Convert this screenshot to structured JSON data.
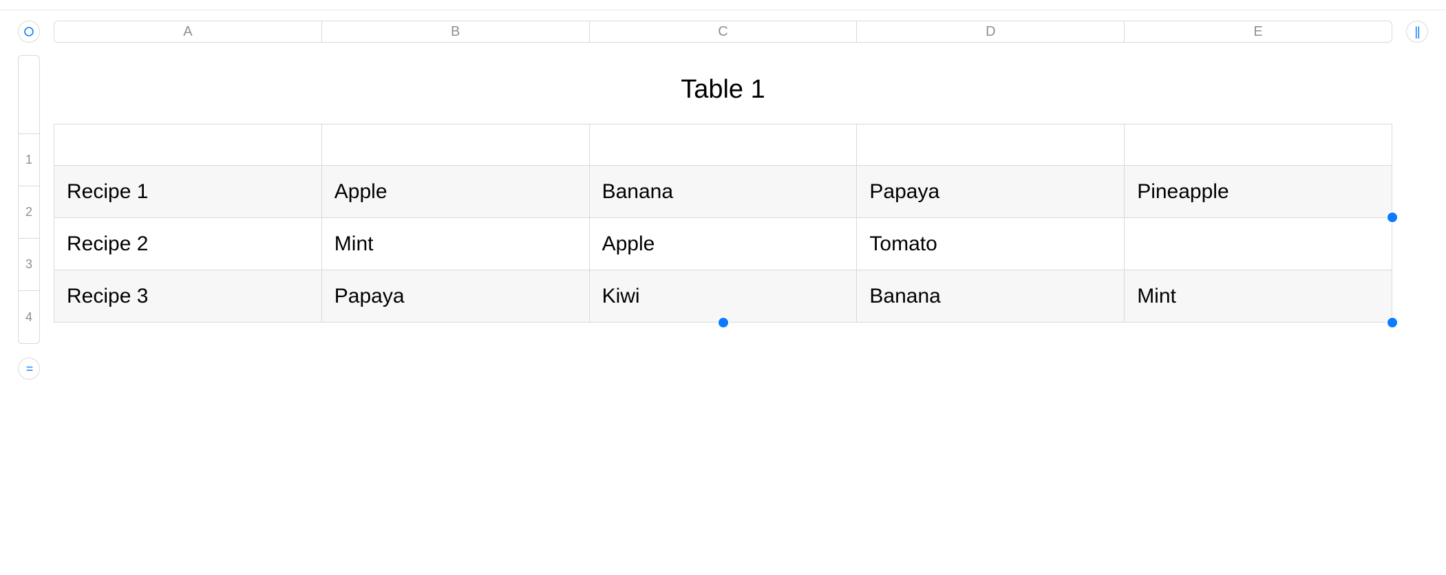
{
  "icons": {
    "add_col_left": "circle",
    "add_col_right": "double-bar",
    "add_row": "equals"
  },
  "column_headers": [
    "A",
    "B",
    "C",
    "D",
    "E"
  ],
  "row_headers": [
    "1",
    "2",
    "3",
    "4"
  ],
  "table": {
    "title": "Table 1",
    "rows": [
      [
        "",
        "",
        "",
        "",
        ""
      ],
      [
        "Recipe 1",
        "Apple",
        "Banana",
        "Papaya",
        "Pineapple"
      ],
      [
        "Recipe 2",
        "Mint",
        "Apple",
        "Tomato",
        ""
      ],
      [
        "Recipe 3",
        "Papaya",
        "Kiwi",
        "Banana",
        "Mint"
      ]
    ]
  },
  "colors": {
    "accent": "#0b7bff"
  }
}
